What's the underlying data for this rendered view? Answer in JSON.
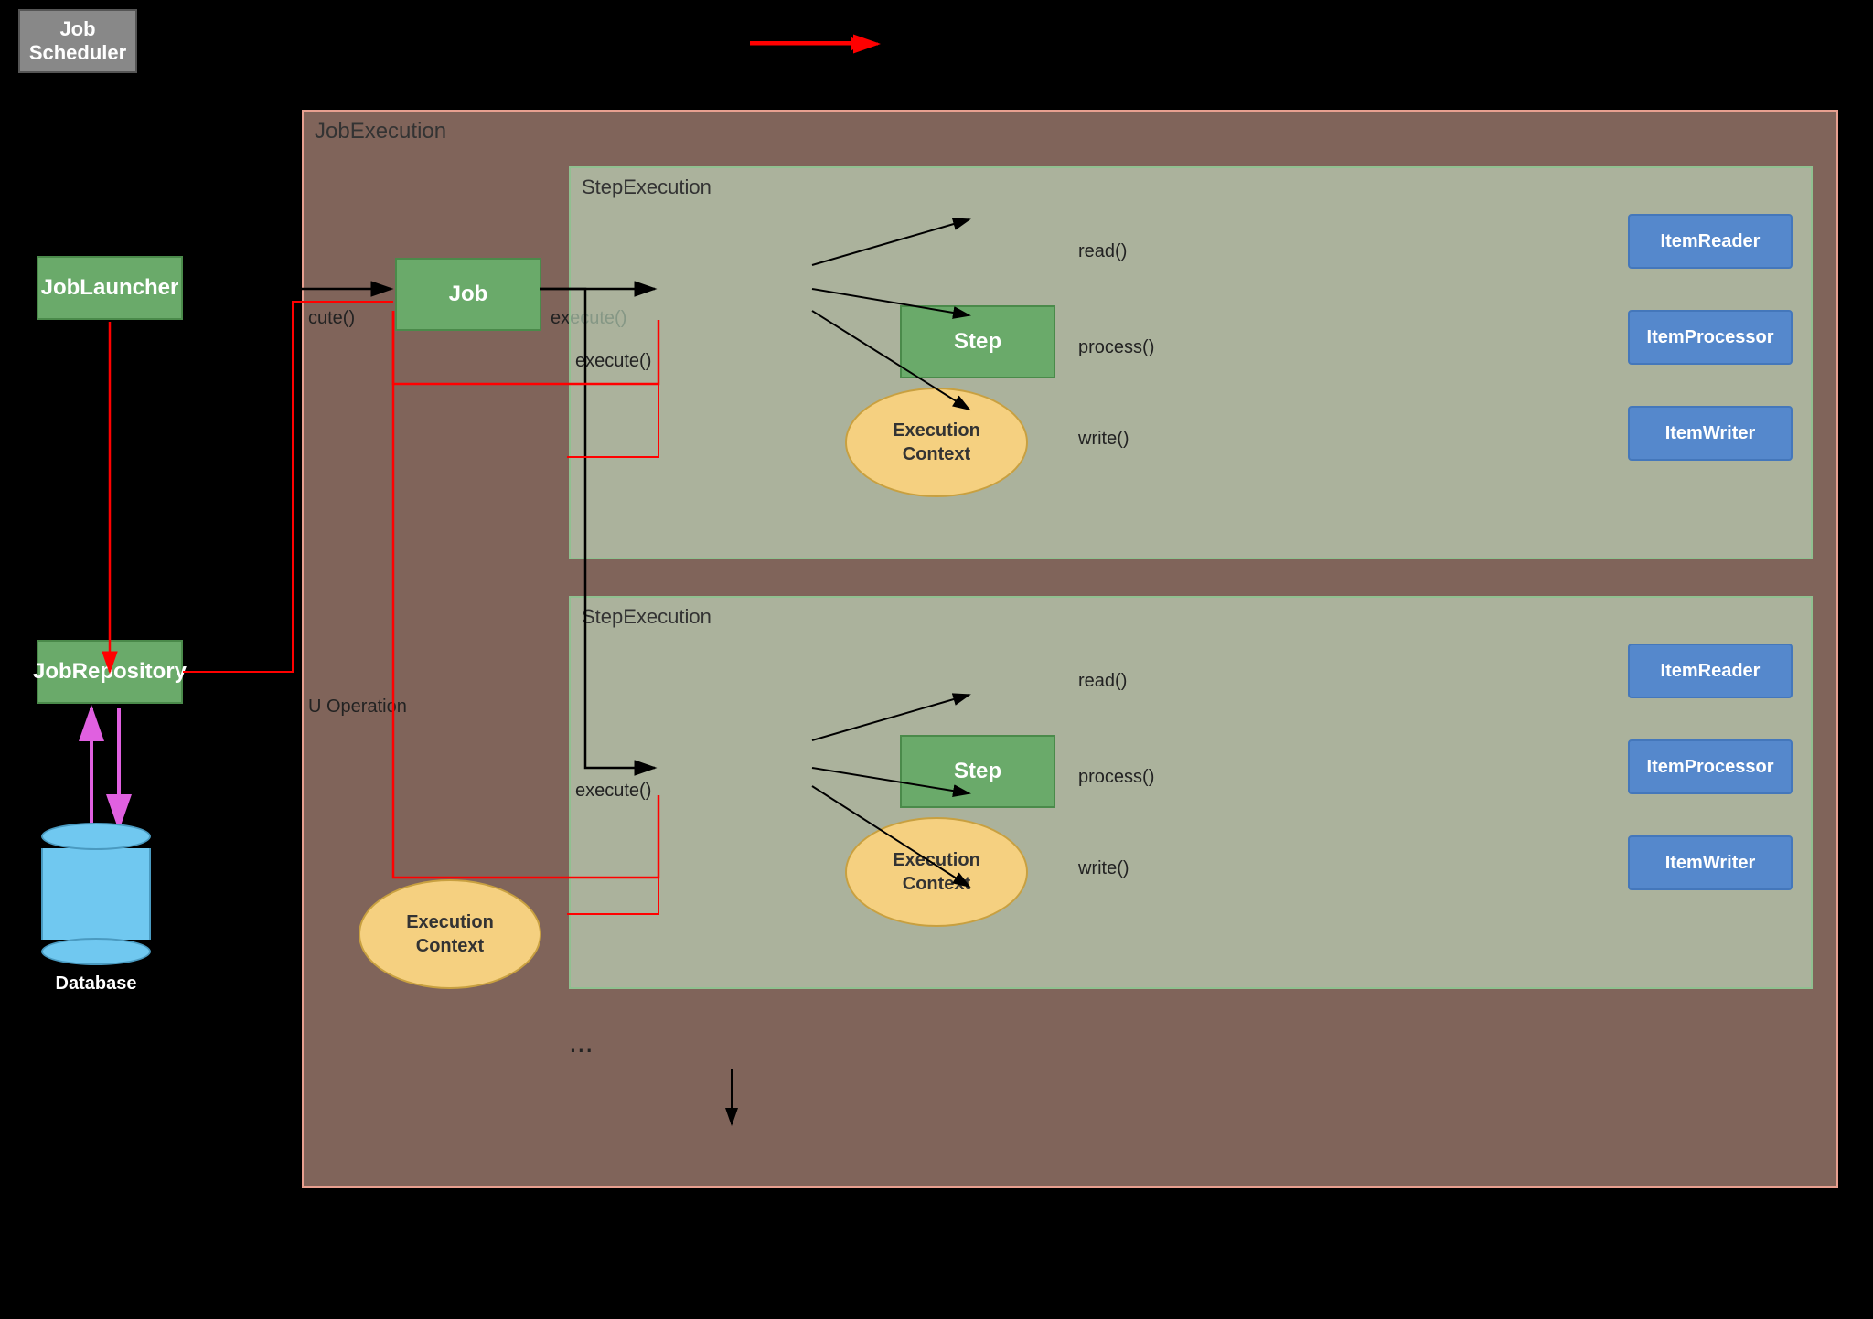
{
  "jobScheduler": {
    "label": "Job\nScheduler"
  },
  "jobExecutionLabel": "JobExecution",
  "stepExecution1Label": "StepExecution",
  "stepExecution2Label": "StepExecution",
  "cruOperation": "U Operation",
  "jobLauncher": "JobLauncher",
  "jobBox": "Job",
  "step1Box": "Step",
  "step2Box": "Step",
  "jobRepository": "JobRepository",
  "database": "Database",
  "executionContext1": "Execution\nContext",
  "executionContext2": "Execution\nContext",
  "executionContextJob": "Execution\nContext",
  "itemReader1": "ItemReader",
  "itemProcessor1": "ItemProcessor",
  "itemWriter1": "ItemWriter",
  "itemReader2": "ItemReader",
  "itemProcessor2": "ItemProcessor",
  "itemWriter2": "ItemWriter",
  "executeLabel1": "execute()",
  "executeLabel2": "execute()",
  "cuteCte": "cute()",
  "read1": "read()",
  "process1": "process()",
  "write1": "write()",
  "read2": "read()",
  "process2": "process()",
  "write2": "write()",
  "ellipsis": "..."
}
